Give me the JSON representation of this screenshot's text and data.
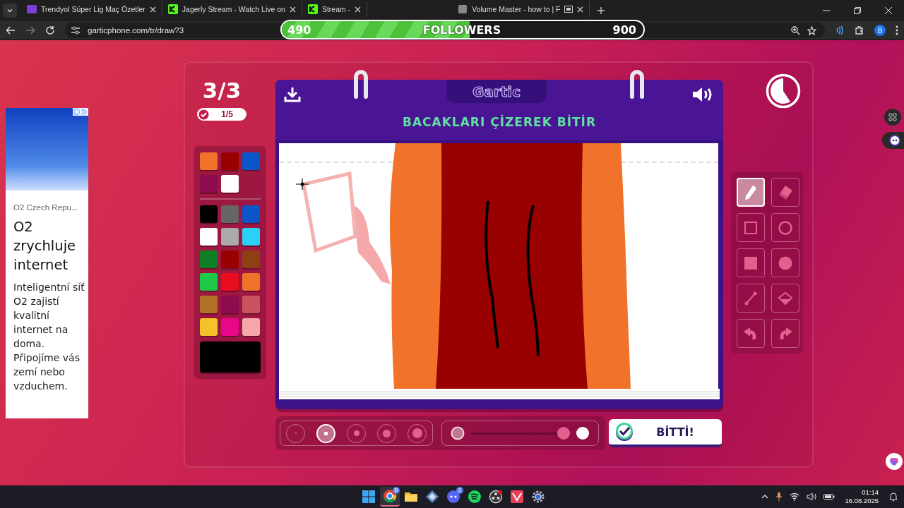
{
  "browser": {
    "tabs": [
      {
        "kind": "video",
        "title": "Trendyol Süper Lig Maç Özetler"
      },
      {
        "kind": "stream",
        "title": "Jagerly Stream - Watch Live on"
      },
      {
        "kind": "stream",
        "title": "Stream -"
      },
      {
        "kind": "page",
        "title": "Volume Master - how to | F"
      }
    ],
    "url": "garticphone.com/tr/draw?3",
    "profile": "B"
  },
  "followers_overlay": {
    "current": "490",
    "label": "FOLLOWERS",
    "goal": "900",
    "level": 0.52
  },
  "ad": {
    "advertiser": "O2 Czech Repu...",
    "headline": "O2 zrychluje internet",
    "body": "Inteligentní síť O2 zajistí kvalitní internet na doma. Připojíme vás zemí nebo vzduchem."
  },
  "game": {
    "round": "3/3",
    "done": "1/5",
    "logo": "Gartic",
    "prompt": "BACAKLARI ÇİZEREK BİTİR",
    "recent_colors": [
      {
        "color": "#f0722b"
      },
      {
        "color": "#990000"
      },
      {
        "color": "#0a55c8"
      },
      {
        "color": "#8e0b4e"
      },
      {
        "color": "#ffffff"
      }
    ],
    "colors": [
      {
        "color": "#000000"
      },
      {
        "color": "#666666"
      },
      {
        "color": "#0a55c8"
      },
      {
        "color": "#ffffff"
      },
      {
        "color": "#aaaaaa"
      },
      {
        "color": "#2bd0f5"
      },
      {
        "color": "#0f7f26"
      },
      {
        "color": "#990000"
      },
      {
        "color": "#8e3f14"
      },
      {
        "color": "#1ec848"
      },
      {
        "color": "#e80e1e"
      },
      {
        "color": "#f0722b"
      },
      {
        "color": "#b07226"
      },
      {
        "color": "#8e0b4e"
      },
      {
        "color": "#c9535e"
      },
      {
        "color": "#f5c22c"
      },
      {
        "color": "#e8068a"
      },
      {
        "color": "#f5a8a9"
      }
    ],
    "current_swatch": {
      "color": "#000000"
    },
    "tools": [
      {
        "kind": "pencil",
        "selected": true
      },
      {
        "kind": "eraser",
        "selected": false
      },
      {
        "kind": "rect",
        "selected": false
      },
      {
        "kind": "ellipse",
        "selected": false
      },
      {
        "kind": "rect-fill",
        "selected": false
      },
      {
        "kind": "ellipse-fill",
        "selected": false
      },
      {
        "kind": "line",
        "selected": false
      },
      {
        "kind": "bucket",
        "selected": false
      },
      {
        "kind": "undo",
        "selected": false
      },
      {
        "kind": "redo",
        "selected": false
      }
    ],
    "brush_sizes": [
      {
        "selected": false
      },
      {
        "selected": true
      },
      {
        "selected": false
      },
      {
        "selected": false
      },
      {
        "selected": false
      }
    ],
    "opacity": {
      "level": 1
    },
    "finish_button": "BİTTİ!"
  },
  "taskbar": {
    "apps": [
      {
        "kind": "start",
        "selected": false
      },
      {
        "kind": "browser",
        "selected": true,
        "badge": "B"
      },
      {
        "kind": "folder",
        "selected": false
      },
      {
        "kind": "cube",
        "selected": false
      },
      {
        "kind": "chat",
        "selected": false,
        "badge": "2"
      },
      {
        "kind": "music",
        "selected": false
      },
      {
        "kind": "recorder",
        "selected": false
      },
      {
        "kind": "game",
        "selected": false
      },
      {
        "kind": "settings",
        "selected": false
      }
    ],
    "time": "01:14",
    "date": "16.08.2025"
  }
}
